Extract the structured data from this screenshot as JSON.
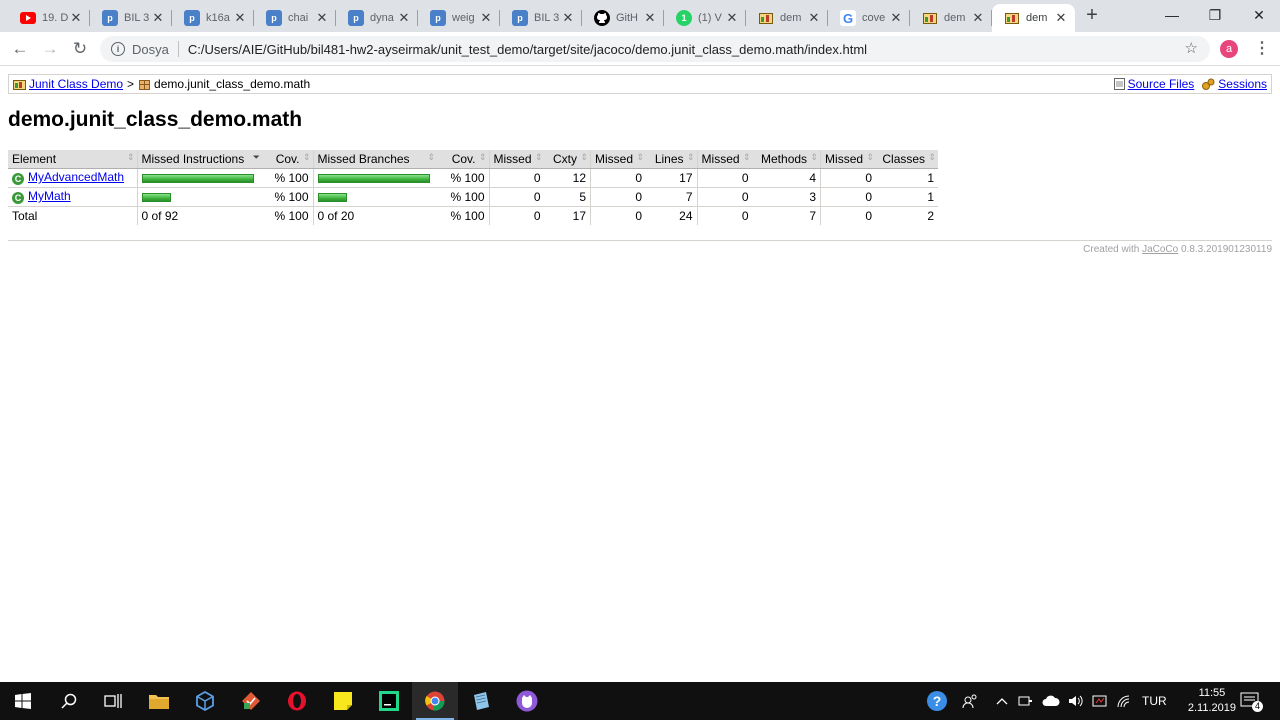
{
  "browser": {
    "tabs": [
      {
        "title": "19. D",
        "icon": "youtube-icon",
        "color": "#ff0000"
      },
      {
        "title": "BIL 3",
        "icon": "p-icon",
        "color": "#4a80c8"
      },
      {
        "title": "k16a",
        "icon": "p-icon",
        "color": "#4a80c8"
      },
      {
        "title": "chai",
        "icon": "p-icon",
        "color": "#4a80c8"
      },
      {
        "title": "dyna",
        "icon": "p-icon",
        "color": "#4a80c8"
      },
      {
        "title": "weig",
        "icon": "p-icon",
        "color": "#4a80c8"
      },
      {
        "title": "BIL 3",
        "icon": "p-icon",
        "color": "#4a80c8"
      },
      {
        "title": "GitH",
        "icon": "github-icon",
        "color": "#000000"
      },
      {
        "title": "(1) V",
        "icon": "whatsapp-icon",
        "color": "#25d366"
      },
      {
        "title": "dem",
        "icon": "jacoco-icon",
        "color": "#8b4513"
      },
      {
        "title": "cove",
        "icon": "google-icon",
        "color": "#4285f4"
      },
      {
        "title": "dem",
        "icon": "jacoco-icon",
        "color": "#8b4513"
      },
      {
        "title": "dem",
        "icon": "jacoco-icon",
        "color": "#8b4513"
      }
    ],
    "tab_glyphs": {
      "p": "p",
      "g": "G",
      "one": "1"
    },
    "close_glyph": "✕",
    "newtab_glyph": "+",
    "window_controls": {
      "minimize": "—",
      "maximize": "❐",
      "close": "✕"
    },
    "nav": {
      "back": "←",
      "forward": "→",
      "reload": "↻"
    },
    "omnibox": {
      "info": "i",
      "scheme_label": "Dosya",
      "url": "C:/Users/AIE/GitHub/bil481-hw2-ayseirmak/unit_test_demo/target/site/jacoco/demo.junit_class_demo.math/index.html",
      "star": "☆"
    },
    "avatar_letter": "a",
    "menu_glyph": "⋮"
  },
  "page": {
    "breadcrumb": {
      "root_link": "Junit Class Demo",
      "separator": ">",
      "current": "demo.junit_class_demo.math",
      "source_files": "Source Files",
      "sessions": "Sessions"
    },
    "title": "demo.junit_class_demo.math",
    "table": {
      "headers": [
        "Element",
        "Missed Instructions",
        "Cov.",
        "Missed Branches",
        "Cov.",
        "Missed",
        "Cxty",
        "Missed",
        "Lines",
        "Missed",
        "Methods",
        "Missed",
        "Classes"
      ],
      "rows": [
        {
          "element": "MyAdvancedMath",
          "instr_bar_fraction": 1.0,
          "instr_cov": "% 100",
          "branch_bar_fraction": 1.0,
          "branch_cov": "% 100",
          "missed_cxty": "0",
          "cxty": "12",
          "missed_lines": "0",
          "lines": "17",
          "missed_methods": "0",
          "methods": "4",
          "missed_classes": "0",
          "classes": "1"
        },
        {
          "element": "MyMath",
          "instr_bar_fraction": 0.26,
          "instr_cov": "% 100",
          "branch_bar_fraction": 0.26,
          "branch_cov": "% 100",
          "missed_cxty": "0",
          "cxty": "5",
          "missed_lines": "0",
          "lines": "7",
          "missed_methods": "0",
          "methods": "3",
          "missed_classes": "0",
          "classes": "1"
        }
      ],
      "total": {
        "label": "Total",
        "instr": "0 of 92",
        "instr_cov": "% 100",
        "branch": "0 of 20",
        "branch_cov": "% 100",
        "missed_cxty": "0",
        "cxty": "17",
        "missed_lines": "0",
        "lines": "24",
        "missed_methods": "0",
        "methods": "7",
        "missed_classes": "0",
        "classes": "2"
      }
    },
    "footer": {
      "prefix": "Created with",
      "link": "JaCoCo",
      "version": "0.8.3.201901230119"
    }
  },
  "taskbar": {
    "tray_lang": "TUR",
    "clock_time": "11:55",
    "clock_date": "2.11.2019",
    "notification_count": "4",
    "accent": "#7fb2e5"
  }
}
